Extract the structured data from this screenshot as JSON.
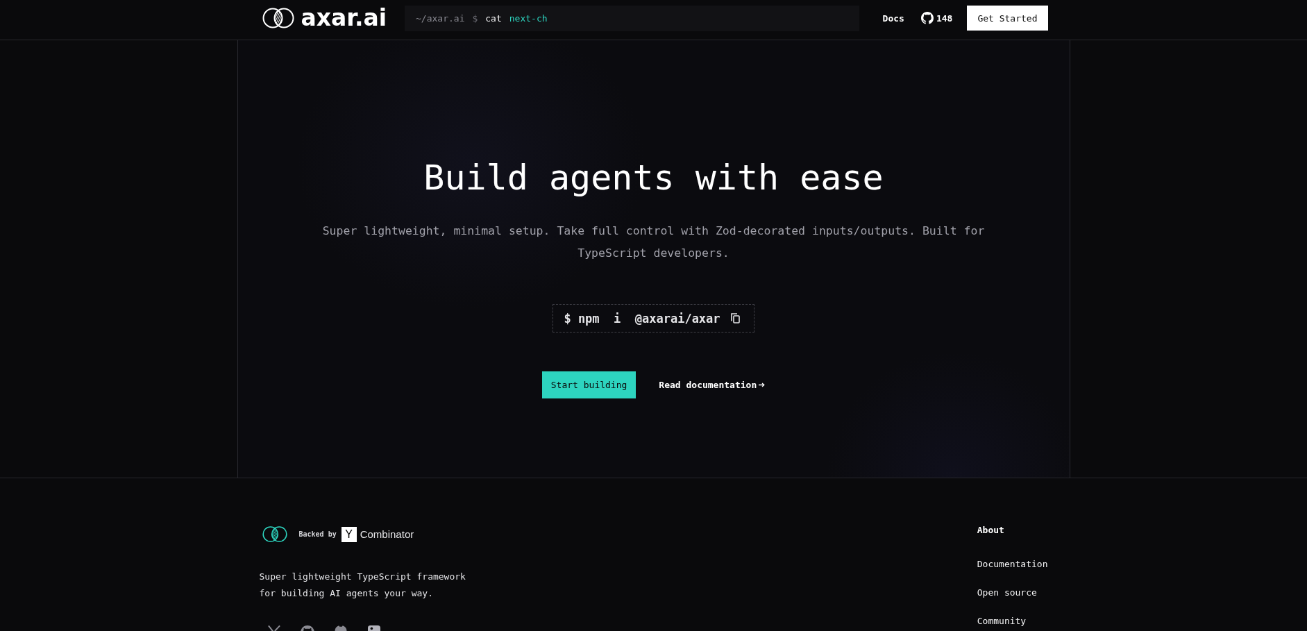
{
  "header": {
    "brand": "axar.ai",
    "terminal": {
      "path": "~/axar.ai",
      "prompt": "$",
      "command": "cat",
      "argument": "next-ch"
    },
    "nav": [
      {
        "label": "Docs",
        "kind": "link"
      },
      {
        "label": "148",
        "kind": "github"
      }
    ],
    "cta": "Get Started"
  },
  "hero": {
    "title": "Build agents with ease",
    "subtitle": "Super lightweight, minimal setup. Take full control with Zod-decorated inputs/outputs. Built for TypeScript developers.",
    "install": "$ npm  i  @axarai/axar",
    "actions": [
      {
        "label": "Start building",
        "kind": "primary"
      },
      {
        "label": "Read documentation",
        "kind": "arrow_link"
      }
    ]
  },
  "footer": {
    "backed": {
      "label": "Backed by",
      "badge": "Y",
      "name": "Combinator"
    },
    "description": "Super lightweight TypeScript framework for building AI agents your way.",
    "column": {
      "heading": "About",
      "links": [
        "Documentation",
        "Open source",
        "Community"
      ]
    }
  }
}
